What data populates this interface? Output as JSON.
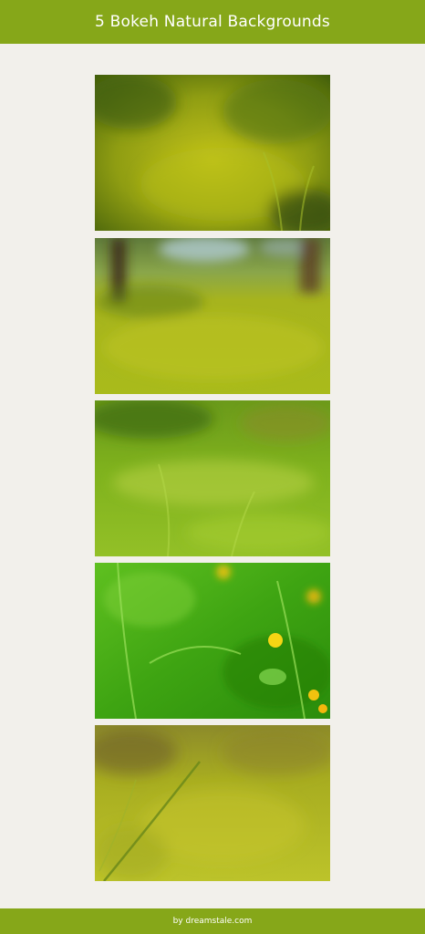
{
  "header": {
    "title": "5 Bokeh Natural Backgrounds",
    "bg_color": "#86a719"
  },
  "footer": {
    "credit": "by dreamstale.com"
  },
  "photos": [
    {
      "name": "bokeh-background-1",
      "palette": [
        "#a9bb17",
        "#5b7d0e",
        "#2e4d08"
      ]
    },
    {
      "name": "bokeh-background-2",
      "palette": [
        "#b3bf1a",
        "#6a8b15",
        "#35210f"
      ]
    },
    {
      "name": "bokeh-background-3",
      "palette": [
        "#8fc21f",
        "#55a012",
        "#c8d94a"
      ]
    },
    {
      "name": "bokeh-background-4",
      "palette": [
        "#49b315",
        "#2a8d0a",
        "#f2c20f"
      ]
    },
    {
      "name": "bokeh-background-5",
      "palette": [
        "#b9b421",
        "#8f9b1b",
        "#4e6b0d"
      ]
    }
  ]
}
